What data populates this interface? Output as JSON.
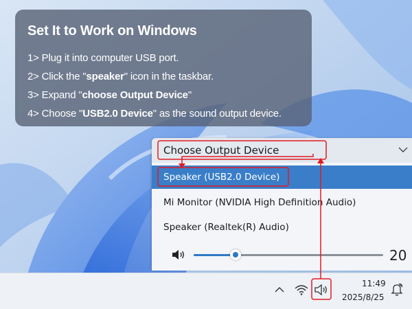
{
  "instructions": {
    "title": "Set It to Work on Windows",
    "steps": [
      {
        "prefix": "1> Plug it into computer USB port.",
        "bold": "",
        "suffix": ""
      },
      {
        "prefix": "2> Click the \"",
        "bold": "speaker",
        "suffix": "\" icon in the taskbar."
      },
      {
        "prefix": "3> Expand \"",
        "bold": "choose Output Device",
        "suffix": "\""
      },
      {
        "prefix": "4> Choose \"",
        "bold": "USB2.0 Device",
        "suffix": "\" as the sound output device."
      }
    ]
  },
  "flyout": {
    "title": "Choose Output Device",
    "devices": [
      {
        "label": "Speaker (USB2.0 Device)",
        "selected": true
      },
      {
        "label": "Mi Monitor (NVIDIA High Definition Audio)",
        "selected": false
      },
      {
        "label": "Speaker (Realtek(R) Audio)",
        "selected": false
      }
    ],
    "volume": {
      "value": "20",
      "level_percent": 22
    }
  },
  "taskbar": {
    "time": "11:49",
    "date": "2025/8/25"
  },
  "colors": {
    "accent": "#3a7ec9",
    "annotation": "#e01b22",
    "card_bg": "#5a6376"
  },
  "icons": {
    "chevron_down": "chevron-down-icon",
    "volume": "speaker-volume-icon",
    "chevron_up": "chevron-up-icon",
    "wifi": "wifi-icon",
    "speaker": "speaker-icon",
    "notification": "notification-bell-icon"
  }
}
